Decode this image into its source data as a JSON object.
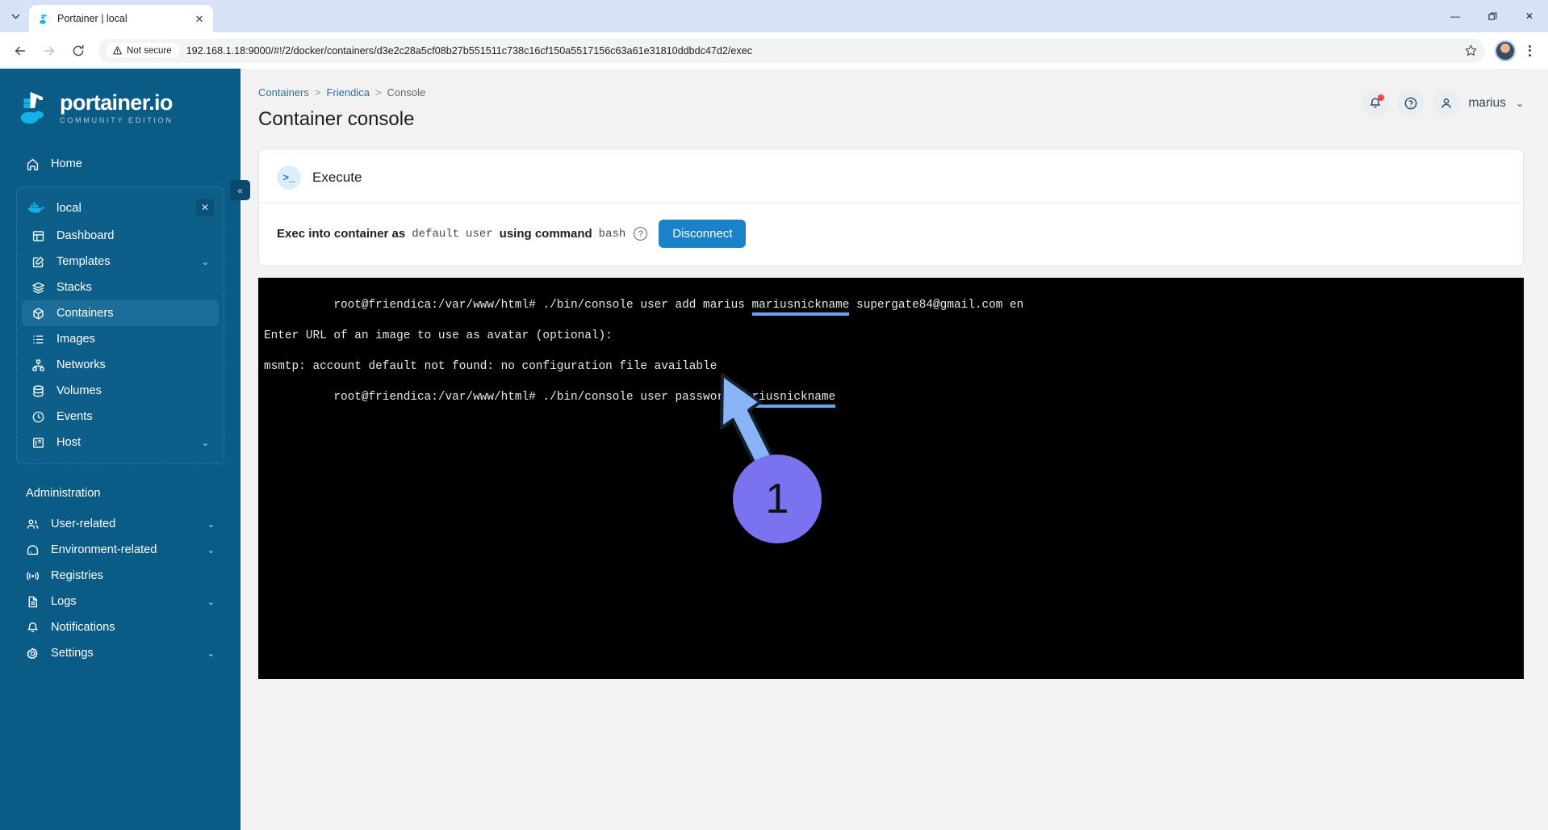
{
  "browser": {
    "tab": {
      "title": "Portainer | local",
      "favicon_icon": "portainer-favicon",
      "close_icon": "close-icon"
    },
    "tab_list_icon": "chevron-down-icon",
    "window": {
      "minimize": "—",
      "restore": "❐",
      "close": "✕"
    },
    "nav": {
      "back_icon": "arrow-left-icon",
      "forward_icon": "arrow-right-icon",
      "reload_icon": "reload-icon"
    },
    "omnibox": {
      "security_label": "Not secure",
      "security_icon": "warning-triangle-icon",
      "url": "192.168.1.18:9000/#!/2/docker/containers/d3e2c28a5cf08b27b551511c738c16cf150a5517156c63a61e31810ddbdc47d2/exec",
      "bookmark_icon": "star-icon"
    },
    "profile_icon": "profile-avatar",
    "menu_icon": "kebab-menu-icon"
  },
  "sidebar": {
    "logo": {
      "word": "portainer.io",
      "subtitle": "COMMUNITY EDITION",
      "mark_icon": "portainer-crane-logo"
    },
    "collapse_icon": "«",
    "home": {
      "label": "Home",
      "icon": "home-icon"
    },
    "environment": {
      "name": "local",
      "icon": "docker-whale-icon",
      "close_icon": "✕",
      "items": [
        {
          "label": "Dashboard",
          "icon": "dashboard-icon",
          "chevron": "",
          "active": false
        },
        {
          "label": "Templates",
          "icon": "templates-icon",
          "chevron": "⌄",
          "active": false
        },
        {
          "label": "Stacks",
          "icon": "stacks-icon",
          "chevron": "",
          "active": false
        },
        {
          "label": "Containers",
          "icon": "containers-icon",
          "chevron": "",
          "active": true
        },
        {
          "label": "Images",
          "icon": "images-icon",
          "chevron": "",
          "active": false
        },
        {
          "label": "Networks",
          "icon": "networks-icon",
          "chevron": "",
          "active": false
        },
        {
          "label": "Volumes",
          "icon": "volumes-icon",
          "chevron": "",
          "active": false
        },
        {
          "label": "Events",
          "icon": "events-clock-icon",
          "chevron": "",
          "active": false
        },
        {
          "label": "Host",
          "icon": "host-icon",
          "chevron": "⌄",
          "active": false
        }
      ]
    },
    "administration": {
      "title": "Administration",
      "items": [
        {
          "label": "User-related",
          "icon": "users-icon",
          "chevron": "⌄"
        },
        {
          "label": "Environment-related",
          "icon": "environment-icon",
          "chevron": "⌄"
        },
        {
          "label": "Registries",
          "icon": "registries-icon",
          "chevron": ""
        },
        {
          "label": "Logs",
          "icon": "logs-icon",
          "chevron": "⌄"
        },
        {
          "label": "Notifications",
          "icon": "bell-icon",
          "chevron": ""
        },
        {
          "label": "Settings",
          "icon": "gear-icon",
          "chevron": "⌄"
        }
      ]
    }
  },
  "header": {
    "breadcrumb": {
      "root": "Containers",
      "sep1": ">",
      "middle": "Friendica",
      "sep2": ">",
      "current": "Console"
    },
    "title": "Container console",
    "notifications_icon": "bell-icon",
    "help_icon": "help-circle-icon",
    "user_icon": "user-icon",
    "username": "marius",
    "user_chevron": "⌄"
  },
  "card": {
    "icon": "terminal-prompt-icon",
    "title": "Execute",
    "exec_label_1": "Exec into container as",
    "exec_user": "default",
    "exec_user_word": "user",
    "exec_label_2": "using command",
    "exec_command": "bash",
    "help_icon": "help-circle-icon",
    "disconnect_label": "Disconnect"
  },
  "terminal": {
    "lines": [
      {
        "text": "root@friendica:/var/www/html# ./bin/console user add marius ",
        "highlight": "mariusnickname",
        "tail": " supergate84@gmail.com en"
      },
      {
        "text": "Enter URL of an image to use as avatar (optional):",
        "highlight": "",
        "tail": ""
      },
      {
        "text": "",
        "highlight": "",
        "tail": ""
      },
      {
        "text": "msmtp: account default not found: no configuration file available",
        "highlight": "",
        "tail": ""
      },
      {
        "text": "root@friendica:/var/www/html# ./bin/console user password ",
        "highlight": "mariusnickname",
        "tail": ""
      }
    ]
  },
  "annotation": {
    "step_number": "1",
    "arrow_icon": "arrow-up-left-icon",
    "arrow_color": "#8ab4f8",
    "circle_color": "#7b72f0"
  },
  "colors": {
    "sidebar_bg": "#0a5c86",
    "sidebar_active": "#1c6d97",
    "accent": "#1a82c9",
    "page_bg": "#f2f2f2",
    "terminal_bg": "#000000",
    "highlight_underline": "#6aa6f0"
  }
}
